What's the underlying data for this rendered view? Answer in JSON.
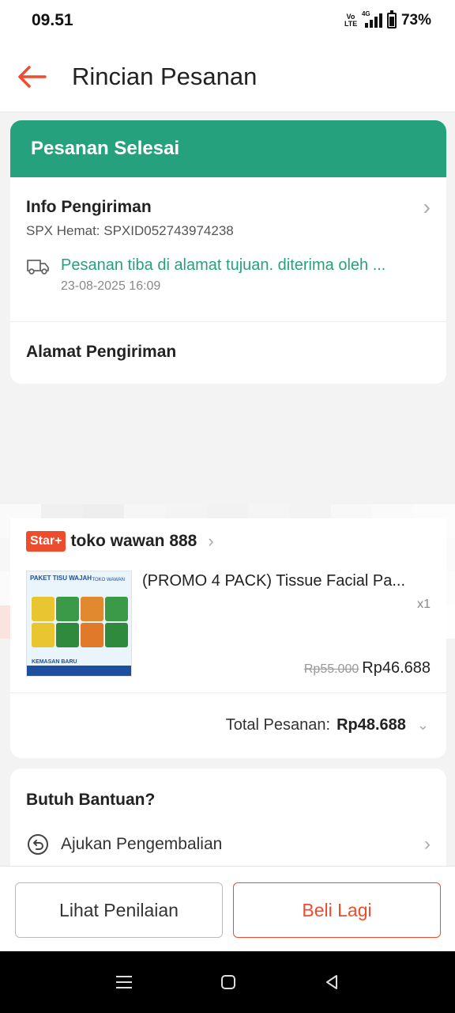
{
  "status_bar": {
    "time": "09.51",
    "network_label": "4G",
    "volte_label": "Vo LTE",
    "battery": "73%",
    "battery_level": 0.73
  },
  "header": {
    "title": "Rincian Pesanan",
    "back_icon": "arrow-left-icon",
    "accent": "#ee4d2d"
  },
  "order_status": {
    "label": "Pesanan Selesai",
    "color": "#26a17e"
  },
  "shipping_info": {
    "title": "Info Pengiriman",
    "courier": "SPX Hemat: SPXID052743974238",
    "tracking_status": "Pesanan tiba di alamat tujuan. diterima oleh ...",
    "tracking_date": "23-08-2025 16:09"
  },
  "address": {
    "title": "Alamat Pengiriman"
  },
  "shop": {
    "badge": "Star+",
    "name": "toko wawan 888"
  },
  "product": {
    "name": "(PROMO 4 PACK) Tissue Facial Pa...",
    "quantity": "x1",
    "original_price": "Rp55.000",
    "price": "Rp46.688",
    "thumb_header": "PAKET TISU WAJAH",
    "thumb_brand": "TOKO WAWAN",
    "thumb_note": "KEMASAN BARU"
  },
  "total": {
    "label": "Total Pesanan:",
    "value": "Rp48.688"
  },
  "help": {
    "title": "Butuh Bantuan?",
    "return_label": "Ajukan Pengembalian"
  },
  "actions": {
    "review_label": "Lihat Penilaian",
    "buy_again_label": "Beli Lagi"
  }
}
